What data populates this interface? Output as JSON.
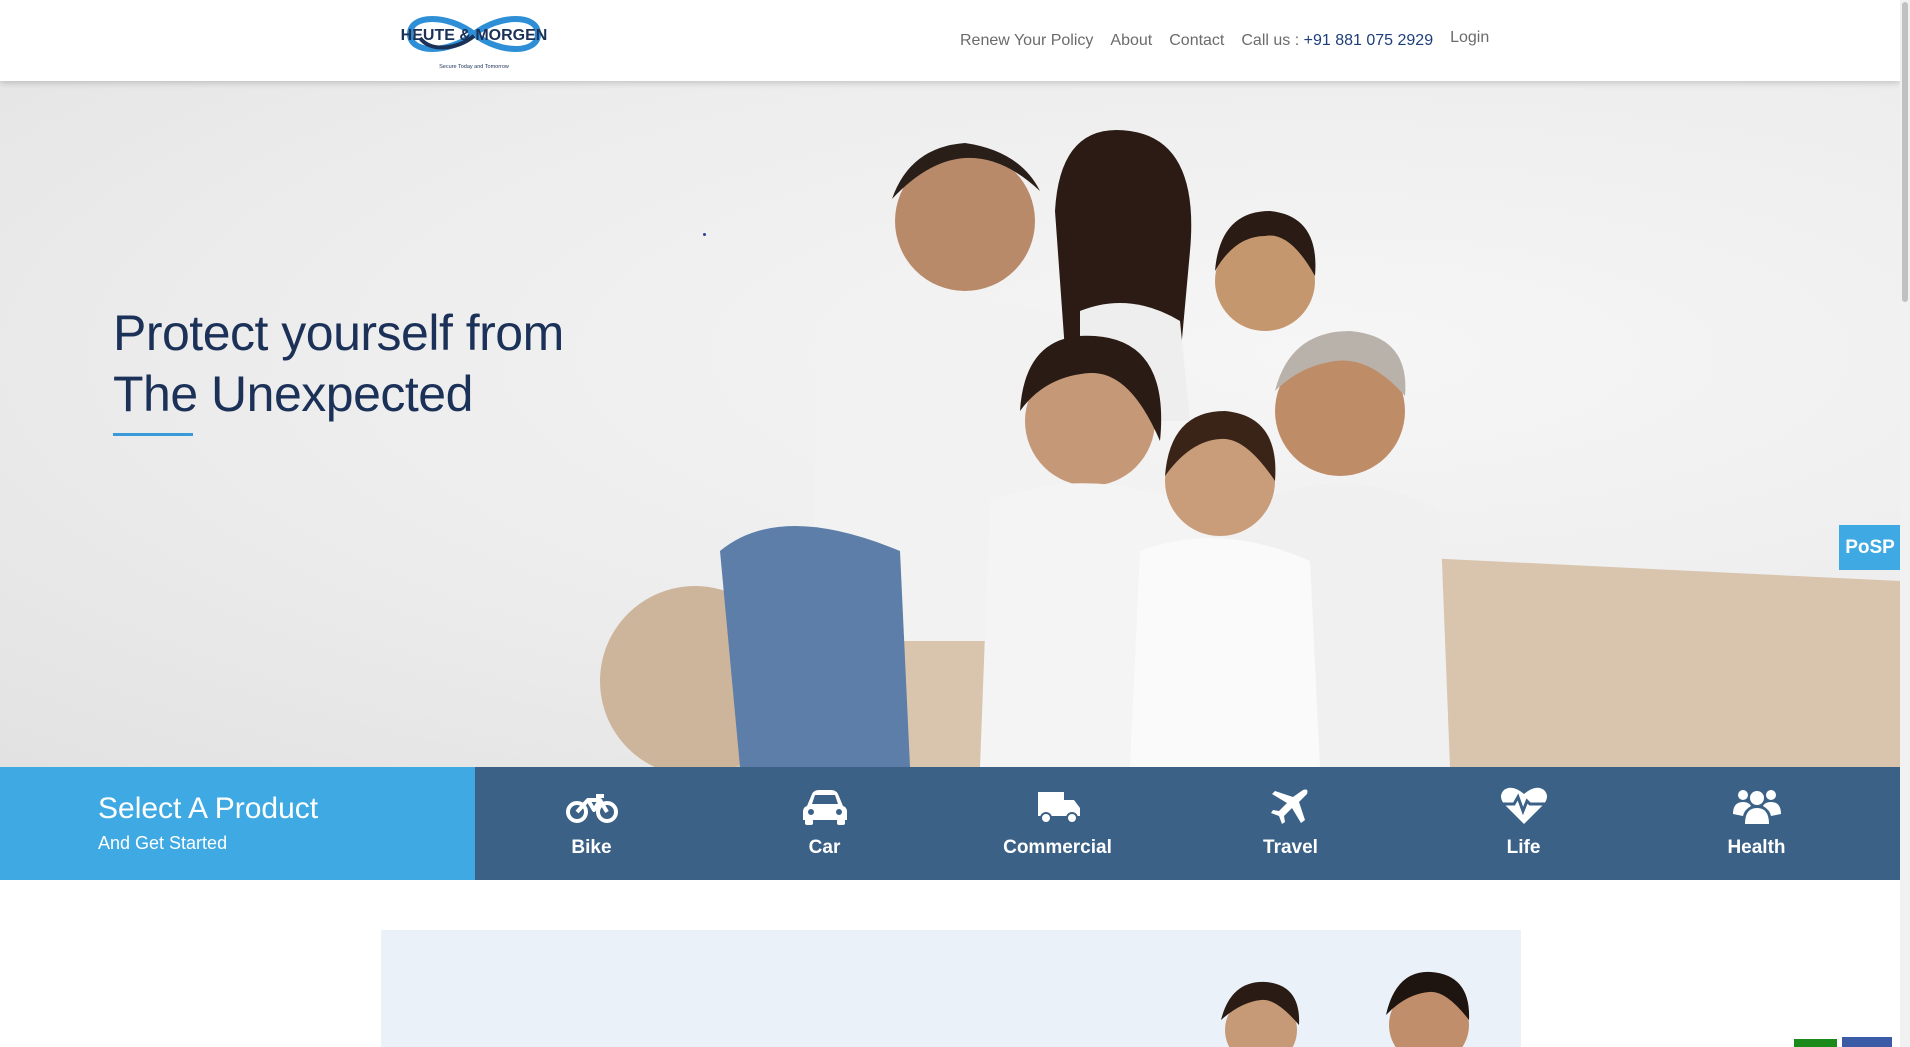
{
  "header": {
    "logo": {
      "brand": "HEUTE & MORGEN",
      "tagline": "Secure Today and Tomorrow"
    },
    "nav": {
      "renew": "Renew Your Policy",
      "about": "About",
      "contact": "Contact",
      "call_prefix": "Call us : ",
      "call_number": "+91 881 075 2929",
      "login": "Login"
    }
  },
  "hero": {
    "title_line1": "Protect yourself from",
    "title_line2": "The Unexpected"
  },
  "posp": {
    "label": "PoSP"
  },
  "product_bar": {
    "title": "Select A Product",
    "subtitle": "And Get Started",
    "products": [
      {
        "label": "Bike",
        "icon": "motorcycle-icon"
      },
      {
        "label": "Car",
        "icon": "car-icon"
      },
      {
        "label": "Commercial",
        "icon": "truck-icon"
      },
      {
        "label": "Travel",
        "icon": "plane-icon"
      },
      {
        "label": "Life",
        "icon": "heartbeat-icon"
      },
      {
        "label": "Health",
        "icon": "users-icon"
      }
    ]
  },
  "colors": {
    "brand_blue": "#3ea9e3",
    "product_bar_dark": "#3b6187",
    "title_navy": "#1b3158",
    "phone_blue": "#1d3e7a"
  }
}
